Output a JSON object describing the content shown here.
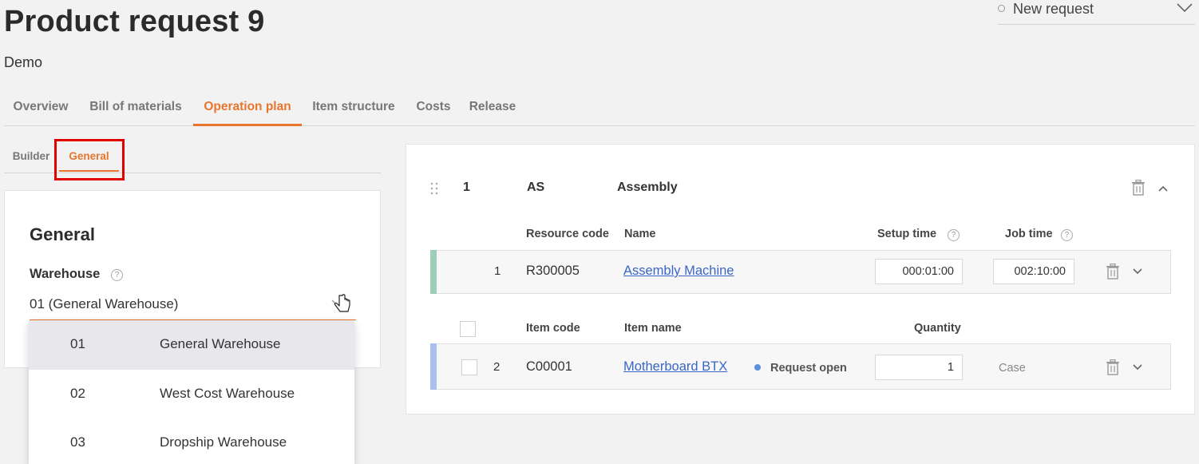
{
  "header": {
    "title": "Product request 9",
    "subtitle": "Demo",
    "status": {
      "label": "New request"
    }
  },
  "main_tabs": [
    {
      "label": "Overview",
      "active": false
    },
    {
      "label": "Bill of materials",
      "active": false
    },
    {
      "label": "Operation plan",
      "active": true
    },
    {
      "label": "Item structure",
      "active": false
    },
    {
      "label": "Costs",
      "active": false
    },
    {
      "label": "Release",
      "active": false
    }
  ],
  "sub_tabs": [
    {
      "label": "Builder",
      "active": false
    },
    {
      "label": "General",
      "active": true
    }
  ],
  "general": {
    "title": "General",
    "warehouse_label": "Warehouse",
    "help": "?",
    "warehouse_value": "01 (General Warehouse)",
    "options": [
      {
        "code": "01",
        "name": "General Warehouse",
        "selected": true
      },
      {
        "code": "02",
        "name": "West Cost Warehouse",
        "selected": false
      },
      {
        "code": "03",
        "name": "Dropship Warehouse",
        "selected": false
      }
    ]
  },
  "operation": {
    "number": "1",
    "code": "AS",
    "name": "Assembly",
    "resource_headers": {
      "code": "Resource code",
      "name": "Name",
      "setup": "Setup time",
      "job": "Job time",
      "help": "?"
    },
    "resource_row": {
      "number": "1",
      "code": "R300005",
      "name": "Assembly Machine",
      "setup_time": "000:01:00",
      "job_time": "002:10:00",
      "stripe_color": "#9dcfb8"
    },
    "item_headers": {
      "code": "Item code",
      "name": "Item name",
      "quantity": "Quantity"
    },
    "item_row": {
      "number": "2",
      "code": "C00001",
      "name": "Motherboard BTX",
      "status": "Request open",
      "status_color": "#5b8fe0",
      "quantity": "1",
      "unit": "Case",
      "stripe_color": "#a9bff0"
    }
  },
  "colors": {
    "accent": "#e8752d",
    "link": "#3a66c4",
    "highlight": "#e00000"
  }
}
